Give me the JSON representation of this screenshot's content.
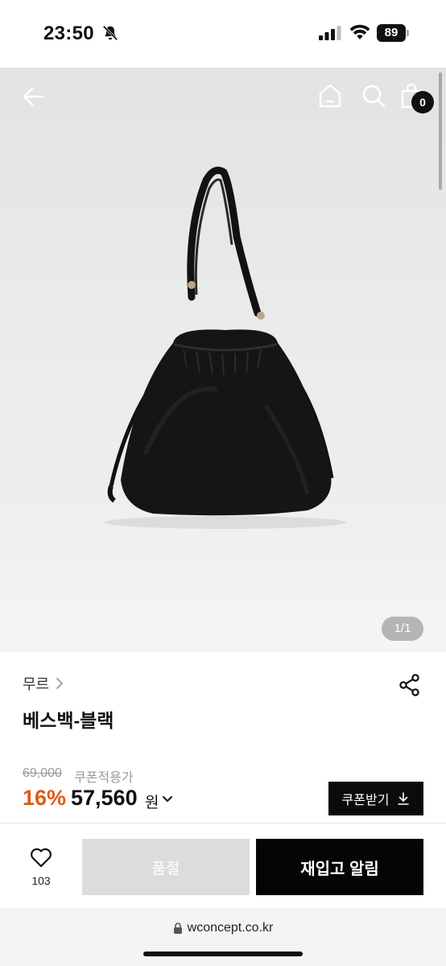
{
  "status_bar": {
    "time": "23:50",
    "battery": "89"
  },
  "hero": {
    "cart_count": "0",
    "page_indicator": "1/1",
    "icons": [
      "back-arrow-icon",
      "home-icon",
      "search-icon",
      "shopping-bag-icon"
    ]
  },
  "product": {
    "brand": "무르",
    "title": "베스백-블랙",
    "original_price": "69,000",
    "coupon_label": "쿠폰적용가",
    "discount": "16%",
    "sale_price": "57,560",
    "currency": "원",
    "coupon_button": "쿠폰받기"
  },
  "actions": {
    "like_count": "103",
    "soldout_label": "품절",
    "restock_label": "재입고 알림"
  },
  "browser": {
    "url": "wconcept.co.kr"
  },
  "colors": {
    "discount": "#e05a18",
    "primary": "#050505",
    "disabled": "#dcdcdc"
  }
}
